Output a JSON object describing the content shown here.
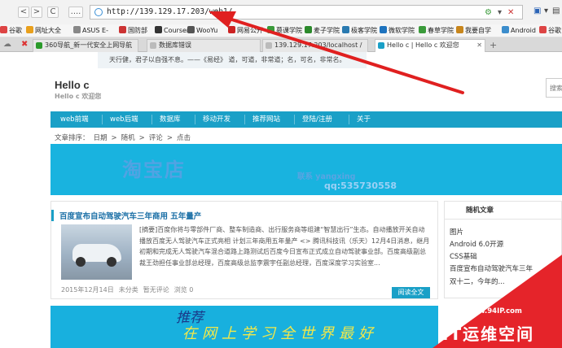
{
  "browser": {
    "url": "http://139.129.17.203/web1/",
    "nav": {
      "back": "<",
      "forward": ">",
      "refresh": "C",
      "apps": "...."
    },
    "bookmarks": [
      {
        "label": "谷歌",
        "color": "#d44"
      },
      {
        "label": "网址大全",
        "color": "#e9a01c"
      },
      {
        "label": "ASUS E-",
        "color": "#888"
      },
      {
        "label": "国防部",
        "color": "#c33"
      },
      {
        "label": "Courser",
        "color": "#333"
      },
      {
        "label": "WooYu",
        "color": "#555"
      },
      {
        "label": "网易公开",
        "color": "#c22"
      },
      {
        "label": "慕课学院",
        "color": "#3a9a3a"
      },
      {
        "label": "麦子学院",
        "color": "#2c8a2c"
      },
      {
        "label": "极客学院",
        "color": "#2a7ab0"
      },
      {
        "label": "微软学院",
        "color": "#1e73be"
      },
      {
        "label": "春草学院",
        "color": "#3b9b3b"
      },
      {
        "label": "我要自学",
        "color": "#c8861c"
      },
      {
        "label": "Android",
        "color": "#3c8dcc"
      },
      {
        "label": "谷歌",
        "color": "#d44"
      }
    ],
    "tabs": [
      {
        "label": "360导航_新一代安全上网导航",
        "color": "#2a9a2a",
        "active": false
      },
      {
        "label": "数据库错误",
        "color": "#999",
        "active": false
      },
      {
        "label": "139.129.17.203/localhost /",
        "color": "#999",
        "active": false
      },
      {
        "label": "Hello c | Hello c 欢迎您",
        "color": "#1aa0c7",
        "active": true
      }
    ],
    "new_tab": "+"
  },
  "page": {
    "motto": "天行健，君子以自强不息。——《易经》          道，可道，非常道；名，可名，非常名。",
    "site_title": "Hello c",
    "site_subtitle": "Hello c 欢迎您",
    "search_placeholder": "搜索",
    "nav_items": [
      "web前端",
      "web后端",
      "数据库",
      "移动开发",
      "推荐网站",
      "登陆/注册",
      "关于"
    ],
    "sort": {
      "label": "文章排序：",
      "options": [
        "日期",
        "随机",
        "评论",
        "点击"
      ],
      "sep": ">"
    },
    "banner": {
      "title": "淘宝店",
      "contact": "联系 yangxing",
      "qq": "qq:535730558"
    },
    "article": {
      "title": "百度宣布自动驾驶汽车三年商用 五年量产",
      "summary": "[摘要]百度你将与零部件厂商、整车制造商、出行服务商等组建“智慧出行”生态。自动播放开关自动播放百度无人驾驶汽车正式亮相 计划三年商用五年量产 <> 腾讯科技讯（乐天）12月4日消息，继月初期和完成无人驾驶汽车混合道路上路测试后百度今日宣布正式成立自动驾驶事业部。百度高级副总裁王劲担任事业部总经理，百度高级总监李震宇任副总经理，百度深度学习实验室...",
      "date": "2015年12月14日",
      "category": "未分类",
      "comments": "暂无评论",
      "views": "浏览 0",
      "read_more": "阅读全文"
    },
    "sidebar": {
      "title": "随机文章",
      "items": [
        "图片",
        "Android 6.0开源",
        "CSS基础",
        "百度宣布自动驾驶汽车三年",
        "双十二，今年的..."
      ]
    },
    "banner2": {
      "line1": "推荐",
      "line2": "在网上学习全世界最好"
    }
  },
  "watermark": {
    "url": "www.94IP.com",
    "text": "IT运维空间"
  },
  "colors": {
    "accent": "#1aa0c7",
    "arrow": "#e02020"
  }
}
